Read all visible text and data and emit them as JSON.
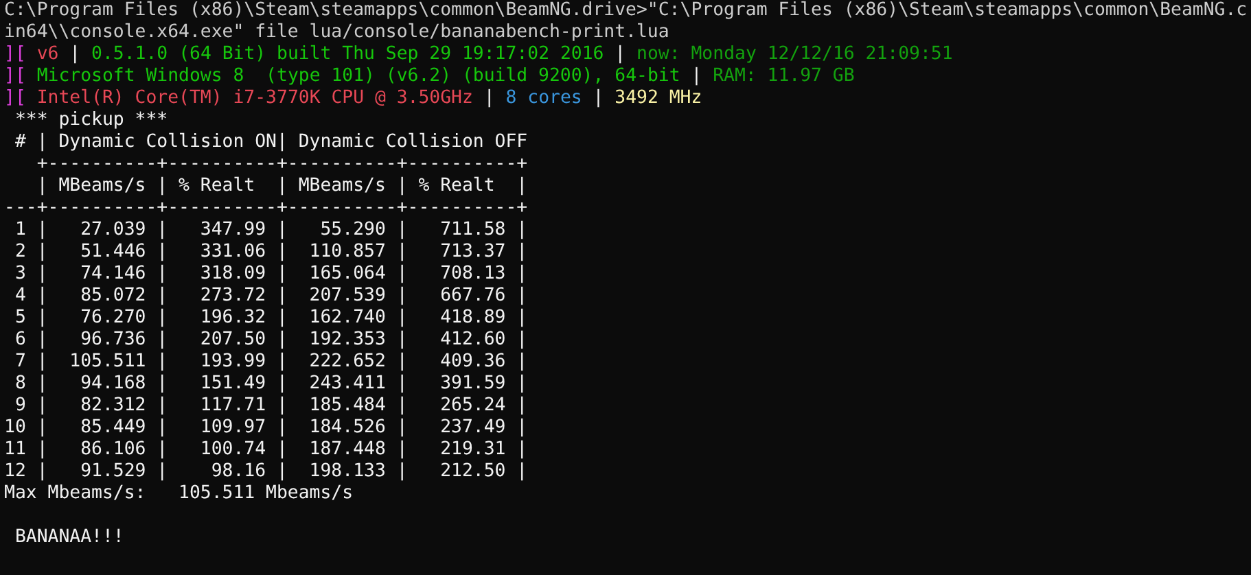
{
  "console": {
    "lines": [
      {
        "kind": "text",
        "segments": [
          {
            "text": "C:\\Program Files (x86)\\Steam\\steamapps\\common\\BeamNG.drive>\"C:\\Program Files (x86)\\Steam\\steamapps\\common\\BeamNG.c",
            "color": "#cccccc"
          }
        ]
      },
      {
        "kind": "text",
        "segments": [
          {
            "text": "in64\\\\console.x64.exe\" file lua/console/bananabench-print.lua",
            "color": "#cccccc"
          }
        ]
      },
      {
        "kind": "text",
        "segments": [
          {
            "text": "][",
            "color": "#e040e0"
          },
          {
            "text": " v6",
            "color": "#e74856"
          },
          {
            "text": " | ",
            "color": "#f2f2f2"
          },
          {
            "text": "0.5.1.0 (64 Bit) built Thu Sep 29 19:17:02 2016",
            "color": "#16c60c"
          },
          {
            "text": " | ",
            "color": "#f2f2f2"
          },
          {
            "text": "now: Monday 12/12/16 21:09:51",
            "color": "#13a10e"
          }
        ]
      },
      {
        "kind": "text",
        "segments": [
          {
            "text": "][",
            "color": "#e040e0"
          },
          {
            "text": " Microsoft Windows 8  (type 101) (v6.2) (build 9200), 64-bit",
            "color": "#16c60c"
          },
          {
            "text": " | ",
            "color": "#f2f2f2"
          },
          {
            "text": "RAM: 11.97 GB",
            "color": "#13a10e"
          }
        ]
      },
      {
        "kind": "text",
        "segments": [
          {
            "text": "][",
            "color": "#e040e0"
          },
          {
            "text": " Intel(R) Core(TM) i7-3770K CPU @ 3.50GHz",
            "color": "#e74856"
          },
          {
            "text": " | ",
            "color": "#f2f2f2"
          },
          {
            "text": "8 cores",
            "color": "#3a96dd"
          },
          {
            "text": " | ",
            "color": "#f2f2f2"
          },
          {
            "text": "3492 MHz",
            "color": "#f9f1a5"
          }
        ]
      },
      {
        "kind": "text",
        "segments": [
          {
            "text": " *** pickup ***",
            "color": "#f2f2f2"
          }
        ]
      },
      {
        "kind": "text",
        "segments": [
          {
            "text": " # | Dynamic Collision ON| Dynamic Collision OFF",
            "color": "#f2f2f2"
          }
        ]
      },
      {
        "kind": "text",
        "segments": [
          {
            "text": "   +----------+----------+----------+----------+",
            "color": "#f2f2f2"
          }
        ]
      },
      {
        "kind": "text",
        "segments": [
          {
            "text": "   | MBeams/s | % Realt  | MBeams/s | % Realt  |",
            "color": "#f2f2f2"
          }
        ]
      },
      {
        "kind": "text",
        "segments": [
          {
            "text": "---+----------+----------+----------+----------+",
            "color": "#f2f2f2"
          }
        ]
      },
      {
        "kind": "text",
        "segments": [
          {
            "text": " 1 |   27.039 |   347.99 |   55.290 |   711.58 |",
            "color": "#f2f2f2"
          }
        ]
      },
      {
        "kind": "text",
        "segments": [
          {
            "text": " 2 |   51.446 |   331.06 |  110.857 |   713.37 |",
            "color": "#f2f2f2"
          }
        ]
      },
      {
        "kind": "text",
        "segments": [
          {
            "text": " 3 |   74.146 |   318.09 |  165.064 |   708.13 |",
            "color": "#f2f2f2"
          }
        ]
      },
      {
        "kind": "text",
        "segments": [
          {
            "text": " 4 |   85.072 |   273.72 |  207.539 |   667.76 |",
            "color": "#f2f2f2"
          }
        ]
      },
      {
        "kind": "text",
        "segments": [
          {
            "text": " 5 |   76.270 |   196.32 |  162.740 |   418.89 |",
            "color": "#f2f2f2"
          }
        ]
      },
      {
        "kind": "text",
        "segments": [
          {
            "text": " 6 |   96.736 |   207.50 |  192.353 |   412.60 |",
            "color": "#f2f2f2"
          }
        ]
      },
      {
        "kind": "text",
        "segments": [
          {
            "text": " 7 |  105.511 |   193.99 |  222.652 |   409.36 |",
            "color": "#f2f2f2"
          }
        ]
      },
      {
        "kind": "text",
        "segments": [
          {
            "text": " 8 |   94.168 |   151.49 |  243.411 |   391.59 |",
            "color": "#f2f2f2"
          }
        ]
      },
      {
        "kind": "text",
        "segments": [
          {
            "text": " 9 |   82.312 |   117.71 |  185.484 |   265.24 |",
            "color": "#f2f2f2"
          }
        ]
      },
      {
        "kind": "text",
        "segments": [
          {
            "text": "10 |   85.449 |   109.97 |  184.526 |   237.49 |",
            "color": "#f2f2f2"
          }
        ]
      },
      {
        "kind": "text",
        "segments": [
          {
            "text": "11 |   86.106 |   100.74 |  187.448 |   219.31 |",
            "color": "#f2f2f2"
          }
        ]
      },
      {
        "kind": "text",
        "segments": [
          {
            "text": "12 |   91.529 |    98.16 |  198.133 |   212.50 |",
            "color": "#f2f2f2"
          }
        ]
      },
      {
        "kind": "text",
        "segments": [
          {
            "text": "Max Mbeams/s:   105.511 Mbeams/s",
            "color": "#f2f2f2"
          }
        ]
      },
      {
        "kind": "blank"
      },
      {
        "kind": "text",
        "segments": [
          {
            "text": " BANANAA!!!",
            "color": "#f2f2f2"
          }
        ]
      }
    ]
  }
}
